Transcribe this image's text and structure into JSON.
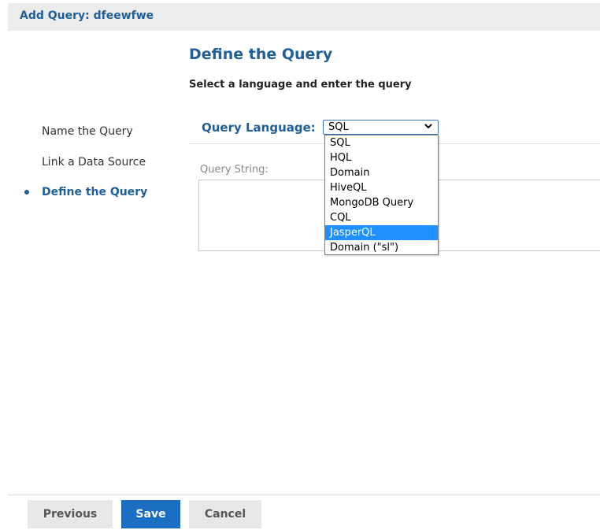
{
  "window": {
    "title": "Add Query: dfeewfwe"
  },
  "steps": [
    {
      "label": "Name the Query",
      "active": false
    },
    {
      "label": "Link a Data Source",
      "active": false
    },
    {
      "label": "Define the Query",
      "active": true
    }
  ],
  "main": {
    "title": "Define the Query",
    "subtitle": "Select a language and enter the query"
  },
  "query_language": {
    "label": "Query Language:",
    "selected": "SQL",
    "options": [
      "SQL",
      "HQL",
      "Domain",
      "HiveQL",
      "MongoDB Query",
      "CQL",
      "JasperQL",
      "Domain (\"sl\")"
    ],
    "highlighted": "JasperQL"
  },
  "query_string": {
    "label": "Query String:",
    "value": ""
  },
  "buttons": {
    "previous": "Previous",
    "save": "Save",
    "cancel": "Cancel"
  },
  "colors": {
    "accent": "#1f5f9a",
    "primary_button": "#1a6fc2",
    "highlight": "#1e90ff"
  }
}
